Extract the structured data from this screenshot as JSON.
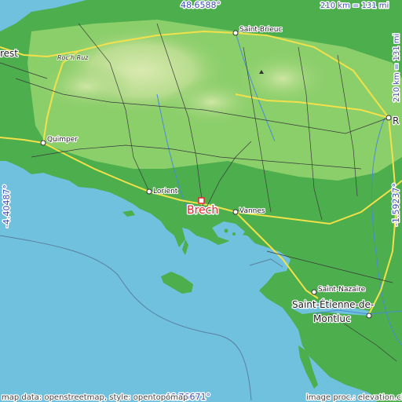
{
  "map": {
    "main_place": "Brech",
    "coordinates": {
      "top_lat": "48.6588°",
      "bottom_lat": "46.76671°",
      "left_lon": "-4.40487°",
      "right_lon": "-1.59237°"
    },
    "scale": {
      "top": "210 km = 131 mi",
      "right": "210 km = 131 mi"
    },
    "cities": [
      {
        "name": "Saint-Brieuc"
      },
      {
        "name": "Roc'h Ruz"
      },
      {
        "name": "rest"
      },
      {
        "name": "R"
      },
      {
        "name": "Quimper"
      },
      {
        "name": "Lorient"
      },
      {
        "name": "Vannes"
      },
      {
        "name": "Saint-Nazaire"
      },
      {
        "name": "Saint-Étienne-de-"
      },
      {
        "name": "Montluc"
      }
    ],
    "attribution": {
      "left": "map data: openstreetmap, style: opentopomap",
      "right": "image proc.: elevation.city"
    },
    "colors": {
      "sea": "#6fc1dd",
      "lowland": "#4cae4c",
      "midland": "#8bcf6a",
      "highland": "#c9e5a0",
      "marker": "#e8242c",
      "coord_text": "#3d4fb8"
    }
  }
}
